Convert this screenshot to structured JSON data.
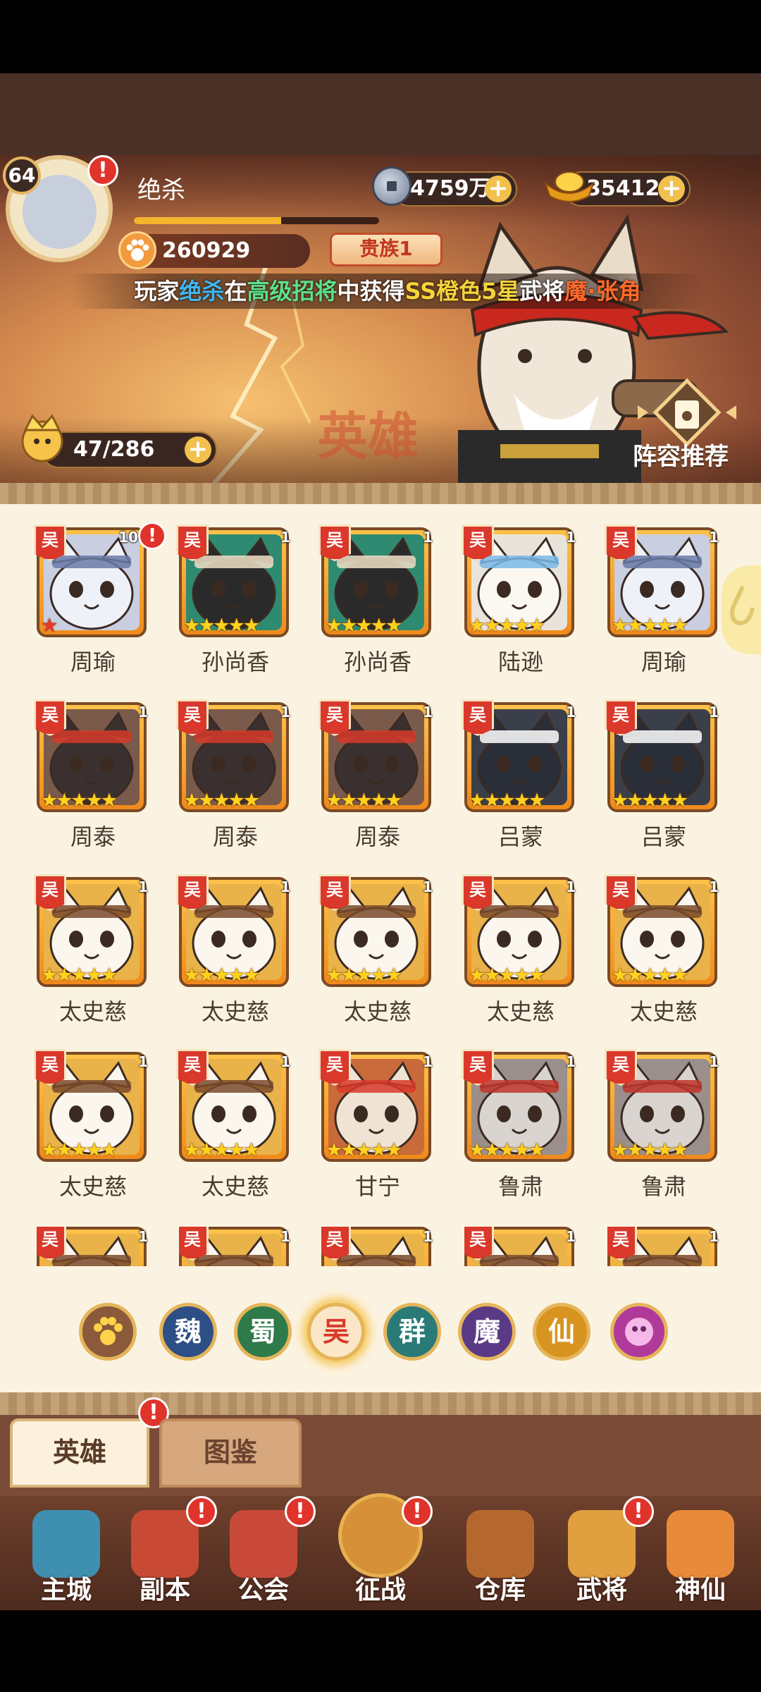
{
  "player": {
    "level": "64",
    "name": "绝杀",
    "power": "260929",
    "noble_rank": "贵族1",
    "exp_fraction": 0.6
  },
  "currency": {
    "copper": "4759万",
    "gold": "35412"
  },
  "broadcast": {
    "prefix": "玩家",
    "player": "绝杀",
    "mid1": "在",
    "pool": "高级招将",
    "mid2": "中获得",
    "grade": "SS橙色5星",
    "mid3": "武将",
    "hero": "魔·张角"
  },
  "hero_count": "47/286",
  "lineup_label": "阵容推荐",
  "watermark": "英雄",
  "alert_mark": "!",
  "faction_tag": "吴",
  "heroes": [
    {
      "name": "周瑜",
      "level": "100",
      "stars": "★",
      "alert": true,
      "palette": "silver"
    },
    {
      "name": "孙尚香",
      "level": "1",
      "stars": "★★★★★",
      "palette": "teal"
    },
    {
      "name": "孙尚香",
      "level": "1",
      "stars": "★★★★★",
      "palette": "teal"
    },
    {
      "name": "陆逊",
      "level": "1",
      "stars": "★★★★★",
      "palette": "white"
    },
    {
      "name": "周瑜",
      "level": "1",
      "stars": "★★★★★",
      "palette": "silver"
    },
    {
      "name": "周泰",
      "level": "1",
      "stars": "★★★★★",
      "palette": "dark"
    },
    {
      "name": "周泰",
      "level": "1",
      "stars": "★★★★★",
      "palette": "dark"
    },
    {
      "name": "周泰",
      "level": "1",
      "stars": "★★★★★",
      "palette": "dark"
    },
    {
      "name": "吕蒙",
      "level": "1",
      "stars": "★★★★★",
      "palette": "black"
    },
    {
      "name": "吕蒙",
      "level": "1",
      "stars": "★★★★★",
      "palette": "black"
    },
    {
      "name": "太史慈",
      "level": "1",
      "stars": "★★★★★",
      "palette": "gold"
    },
    {
      "name": "太史慈",
      "level": "1",
      "stars": "★★★★★",
      "palette": "gold"
    },
    {
      "name": "太史慈",
      "level": "1",
      "stars": "★★★★★",
      "palette": "gold"
    },
    {
      "name": "太史慈",
      "level": "1",
      "stars": "★★★★★",
      "palette": "gold"
    },
    {
      "name": "太史慈",
      "level": "1",
      "stars": "★★★★★",
      "palette": "gold"
    },
    {
      "name": "太史慈",
      "level": "1",
      "stars": "★★★★★",
      "palette": "gold"
    },
    {
      "name": "太史慈",
      "level": "1",
      "stars": "★★★★★",
      "palette": "gold"
    },
    {
      "name": "甘宁",
      "level": "1",
      "stars": "★★★★★",
      "palette": "red"
    },
    {
      "name": "鲁肃",
      "level": "1",
      "stars": "★★★★★",
      "palette": "grey"
    },
    {
      "name": "鲁肃",
      "level": "1",
      "stars": "★★★★★",
      "palette": "grey"
    },
    {
      "name": "",
      "level": "1",
      "stars": "",
      "palette": "gold"
    },
    {
      "name": "",
      "level": "1",
      "stars": "",
      "palette": "gold"
    },
    {
      "name": "",
      "level": "1",
      "stars": "",
      "palette": "gold"
    },
    {
      "name": "",
      "level": "1",
      "stars": "",
      "palette": "gold"
    },
    {
      "name": "",
      "level": "1",
      "stars": "",
      "palette": "gold"
    }
  ],
  "factions": [
    {
      "label": "",
      "icon": "paw-icon",
      "color": "#8a5a3a"
    },
    {
      "label": "魏",
      "color": "#2e4f86"
    },
    {
      "label": "蜀",
      "color": "#2f7a4a"
    },
    {
      "label": "吴",
      "color": "#d9382a",
      "active": true
    },
    {
      "label": "群",
      "color": "#2a7a78"
    },
    {
      "label": "魔",
      "color": "#5a3a86"
    },
    {
      "label": "仙",
      "color": "#d89420"
    },
    {
      "label": "",
      "icon": "spirit-icon",
      "color": "#b03a9a"
    }
  ],
  "tabs": {
    "heroes": "英雄",
    "codex": "图鉴"
  },
  "nav": [
    {
      "label": "主城",
      "icon": "city-icon",
      "color": "#3f8fb0"
    },
    {
      "label": "副本",
      "icon": "sword-icon",
      "color": "#c84a34",
      "alert": true
    },
    {
      "label": "公会",
      "icon": "guild-flag-icon",
      "color": "#c94a3a",
      "alert": true
    },
    {
      "label": "征战",
      "icon": "battle-icon",
      "color": "#d59038",
      "alert": true
    },
    {
      "label": "仓库",
      "icon": "bag-icon",
      "color": "#b5682e"
    },
    {
      "label": "武将",
      "icon": "general-icon",
      "color": "#e0a040",
      "alert": true
    },
    {
      "label": "神仙",
      "icon": "cat-icon",
      "color": "#e88a3a"
    }
  ],
  "colors": {
    "accent": "#f1c04d",
    "alert": "#e0332b",
    "panel": "#fbf3e2"
  }
}
